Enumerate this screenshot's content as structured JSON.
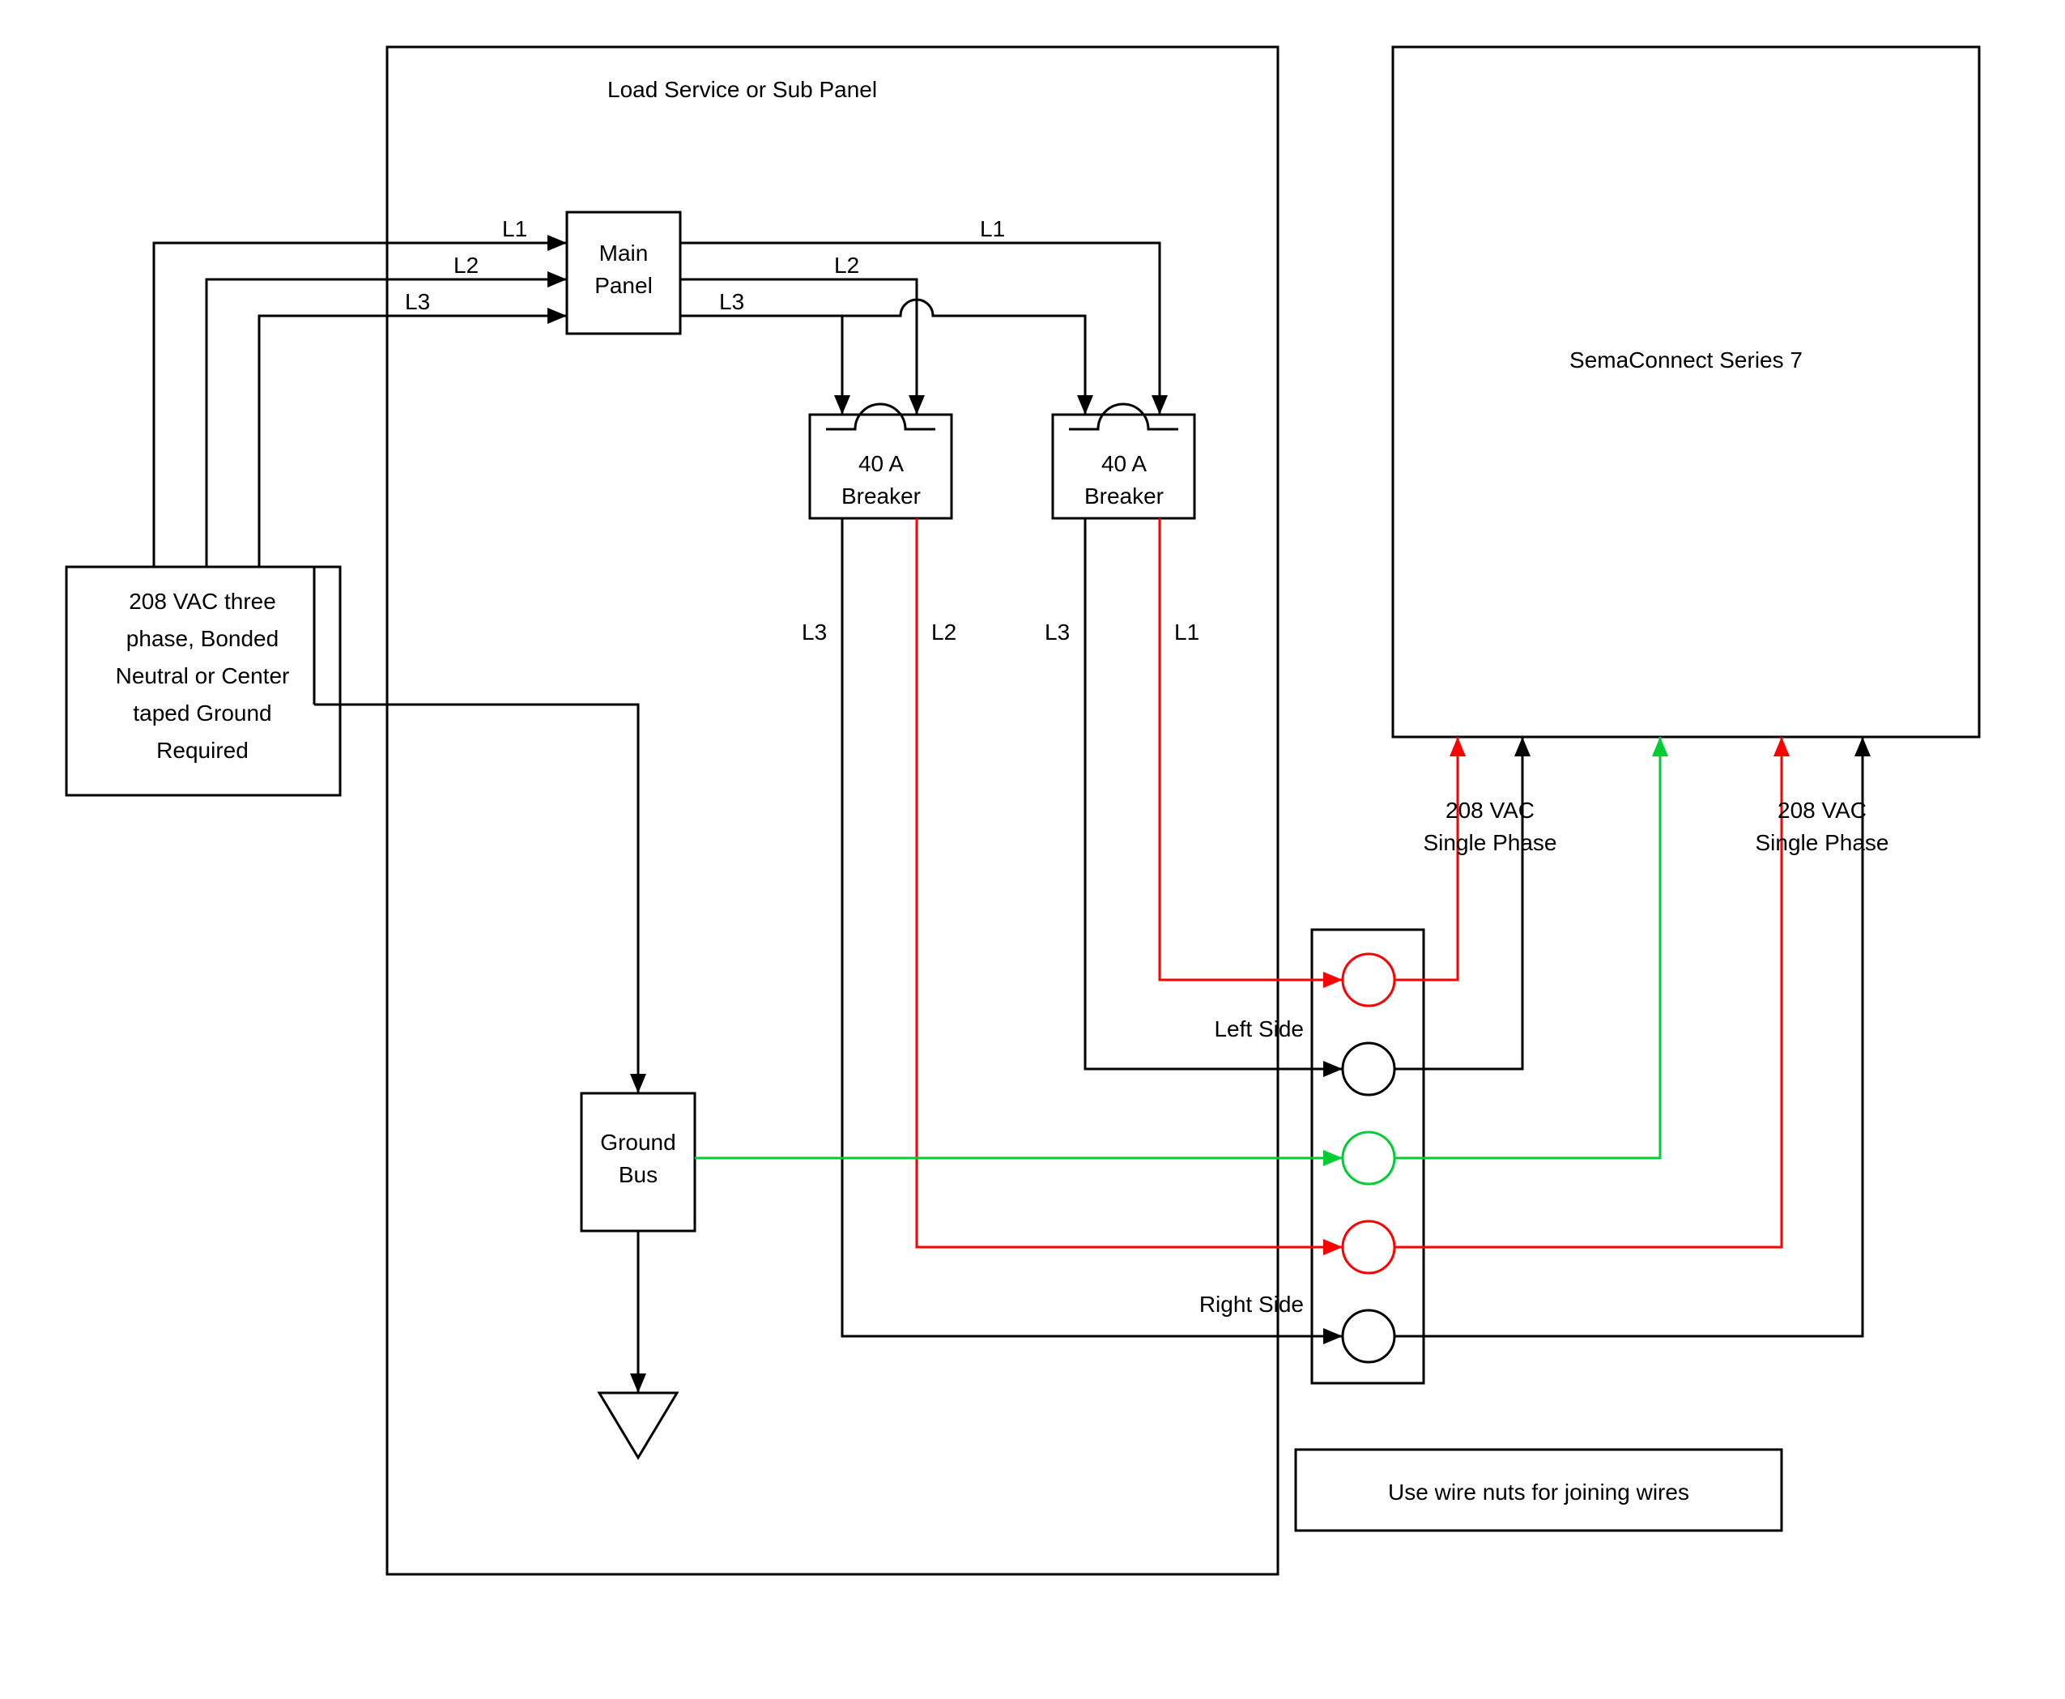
{
  "supply": {
    "line1": "208 VAC three",
    "line2": "phase, Bonded",
    "line3": "Neutral or Center",
    "line4": "taped Ground",
    "line5": "Required"
  },
  "subpanel": {
    "title": "Load Service or Sub Panel"
  },
  "mainpanel": {
    "line1": "Main",
    "line2": "Panel"
  },
  "breaker1": {
    "line1": "40 A",
    "line2": "Breaker"
  },
  "breaker2": {
    "line1": "40 A",
    "line2": "Breaker"
  },
  "groundbus": {
    "line1": "Ground",
    "line2": "Bus"
  },
  "charger": {
    "title": "SemaConnect Series 7"
  },
  "labels": {
    "L1_in": "L1",
    "L2_in": "L2",
    "L3_in": "L3",
    "L1_top": "L1",
    "L2_top": "L2",
    "L3_top": "L3",
    "b1_left": "L3",
    "b1_right": "L2",
    "b2_left": "L3",
    "b2_right": "L1",
    "leftside": "Left Side",
    "rightside": "Right Side",
    "vac1": "208 VAC",
    "sp1": "Single Phase",
    "vac2": "208 VAC",
    "sp2": "Single Phase",
    "wirenuts": "Use wire nuts for joining wires"
  }
}
